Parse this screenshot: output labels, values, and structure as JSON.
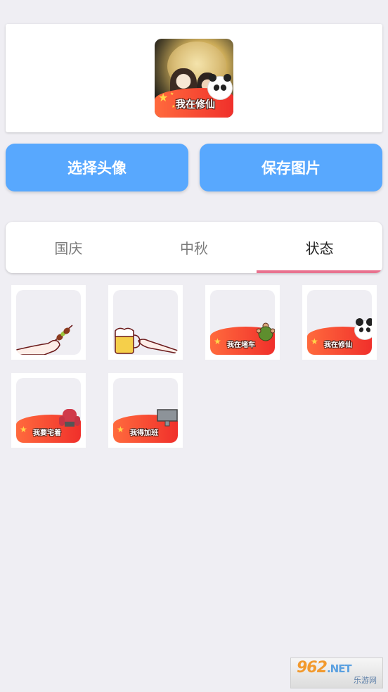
{
  "preview": {
    "avatar_caption": "我在修仙",
    "frame_badge_icon": "panda-icon"
  },
  "buttons": {
    "choose_avatar": "选择头像",
    "save_image": "保存图片"
  },
  "tabs": [
    {
      "label": "国庆",
      "active": false
    },
    {
      "label": "中秋",
      "active": false
    },
    {
      "label": "状态",
      "active": true
    }
  ],
  "colors": {
    "button_bg": "#58a8fe",
    "tab_indicator": "#e8728f",
    "frame_red": "#f0302b"
  },
  "frames": [
    {
      "caption": "",
      "icon": "skewer-icon"
    },
    {
      "caption": "",
      "icon": "beer-mug-icon"
    },
    {
      "caption": "我在堵车",
      "icon": "turtle-icon"
    },
    {
      "caption": "我在修仙",
      "icon": "panda-icon"
    },
    {
      "caption": "我要宅着",
      "icon": "armchair-icon"
    },
    {
      "caption": "我得加班",
      "icon": "computer-monitor-icon"
    }
  ],
  "watermark": {
    "number": "962",
    "domain": ".NET",
    "name": "乐游网"
  }
}
